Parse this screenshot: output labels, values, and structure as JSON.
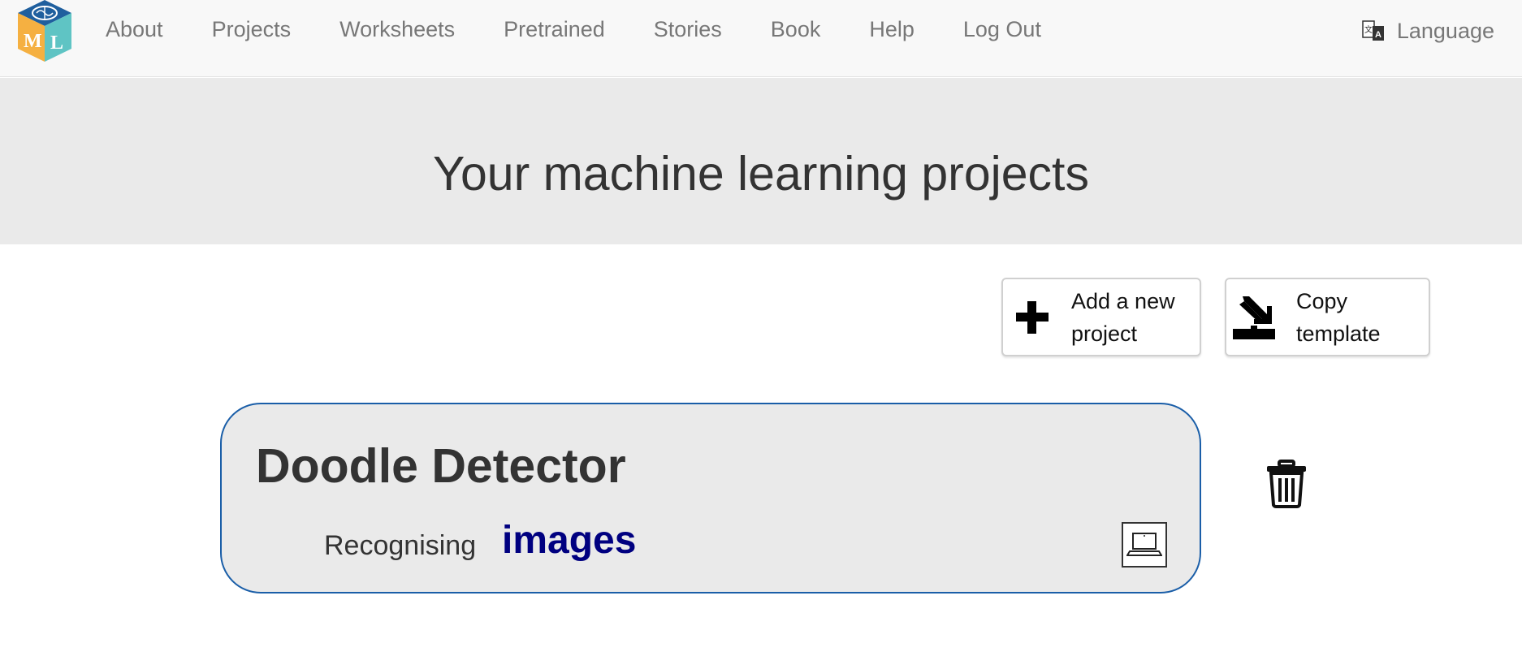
{
  "nav": {
    "logo_alt": "ML",
    "links": [
      "About",
      "Projects",
      "Worksheets",
      "Pretrained",
      "Stories",
      "Book",
      "Help",
      "Log Out"
    ],
    "language_label": "Language"
  },
  "hero": {
    "title": "Your machine learning projects"
  },
  "actions": {
    "add_label": "Add a new project",
    "copy_label": "Copy template"
  },
  "projects": [
    {
      "name": "Doodle Detector",
      "type_prefix": "Recognising",
      "type": "images",
      "storage_icon": "laptop-icon"
    }
  ],
  "colors": {
    "nav_bg": "#f8f8f8",
    "hero_bg": "#eaeaea",
    "card_border": "#1a5ea8",
    "project_type": "#000080"
  }
}
